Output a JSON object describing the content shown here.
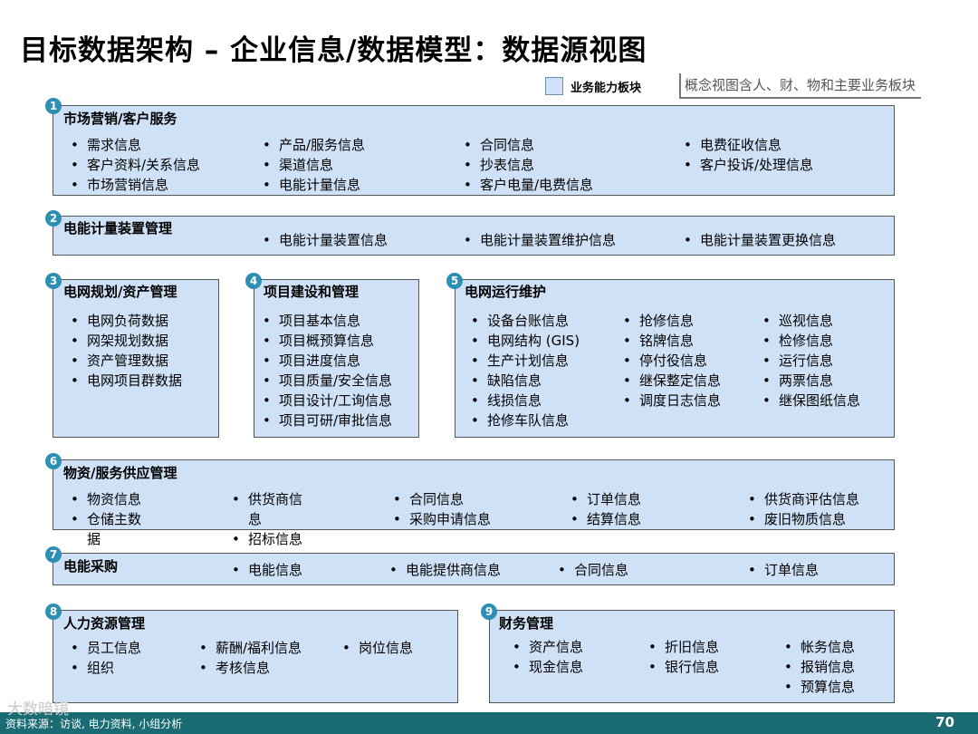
{
  "title": "目标数据架构 – 企业信息/数据模型：数据源视图",
  "legend": {
    "label": "业务能力板块"
  },
  "note": "概念视图含人、财、物和主要业务板块",
  "blocks": [
    {
      "num": "1",
      "title": "市场营销/客户服务",
      "items": [
        "需求信息",
        "客户资料/关系信息",
        "市场营销信息",
        "产品/服务信息",
        "渠道信息",
        "电能计量信息",
        "合同信息",
        "抄表信息",
        "客户电量/电费信息",
        "电费征收信息",
        "客户投诉/处理信息"
      ]
    },
    {
      "num": "2",
      "title": "电能计量装置管理",
      "items": [
        "电能计量装置信息",
        "电能计量装置维护信息",
        "电能计量装置更换信息"
      ]
    },
    {
      "num": "3",
      "title": "电网规划/资产管理",
      "items": [
        "电网负荷数据",
        "网架规划数据",
        "资产管理数据",
        "电网项目群数据"
      ]
    },
    {
      "num": "4",
      "title": "项目建设和管理",
      "items": [
        "项目基本信息",
        "项目概预算信息",
        "项目进度信息",
        "项目质量/安全信息",
        "项目设计/工询信息",
        "项目可研/审批信息"
      ]
    },
    {
      "num": "5",
      "title": "电网运行维护",
      "items": [
        "设备台账信息",
        "电网结构 (GIS)",
        "生产计划信息",
        "缺陷信息",
        "线损信息",
        "抢修车队信息",
        "抢修信息",
        "铭牌信息",
        "停付役信息",
        "继保整定信息",
        "调度日志信息",
        "巡视信息",
        "检修信息",
        "运行信息",
        "两票信息",
        "继保图纸信息"
      ]
    },
    {
      "num": "6",
      "title": "物资/服务供应管理",
      "items": [
        "物资信息",
        "仓储主数",
        "据",
        "供货商信",
        "息",
        "招标信息",
        "合同信息",
        "采购申请信息",
        "订单信息",
        "结算信息",
        "供货商评估信息",
        "废旧物质信息"
      ]
    },
    {
      "num": "7",
      "title": "电能采购",
      "items": [
        "电能信息",
        "电能提供商信息",
        "合同信息",
        "订单信息"
      ]
    },
    {
      "num": "8",
      "title": "人力资源管理",
      "items": [
        "员工信息",
        "组织",
        "薪酬/福利信息",
        "考核信息",
        "岗位信息"
      ]
    },
    {
      "num": "9",
      "title": "财务管理",
      "items": [
        "资产信息",
        "现金信息",
        "折旧信息",
        "银行信息",
        "帐务信息",
        "报销信息",
        "预算信息"
      ]
    }
  ],
  "footer": {
    "source": "资料来源：访谈, 电力资料, 小组分析",
    "page": "70",
    "watermark": "大数暗镜"
  }
}
